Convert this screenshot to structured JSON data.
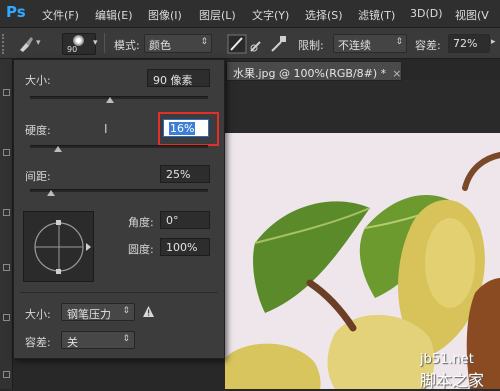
{
  "app": {
    "logo": "Ps"
  },
  "menu": [
    "文件(F)",
    "编辑(E)",
    "图像(I)",
    "图层(L)",
    "文字(Y)",
    "选择(S)",
    "滤镜(T)",
    "3D(D)",
    "视图(V"
  ],
  "options_bar": {
    "brush_size": "90",
    "mode_label": "模式:",
    "mode_value": "颜色",
    "limit_label": "限制:",
    "limit_value": "不连续",
    "tolerance_label": "容差:",
    "tolerance_value": "72%"
  },
  "document_tab": {
    "title": "水果.jpg @ 100%(RGB/8#) *",
    "close": "×"
  },
  "brush_panel": {
    "size_label": "大小:",
    "size_value": "90 像素",
    "size_fraction": 0.45,
    "hardness_label": "硬度:",
    "hardness_value": "16%",
    "hardness_fraction": 0.16,
    "spacing_label": "间距:",
    "spacing_value": "25%",
    "spacing_fraction": 0.12,
    "angle_label": "角度:",
    "angle_value": "0°",
    "roundness_label": "圆度:",
    "roundness_value": "100%",
    "size_control_label": "大小:",
    "size_control_value": "钢笔压力",
    "tolerance_label": "容差:",
    "tolerance_value": "关"
  },
  "watermark": {
    "line1": "jb51.net",
    "line2": "脚本之家"
  },
  "colors": {
    "accent": "#31a8ff",
    "highlight": "#e0302a",
    "selection": "#3d7fd6"
  }
}
